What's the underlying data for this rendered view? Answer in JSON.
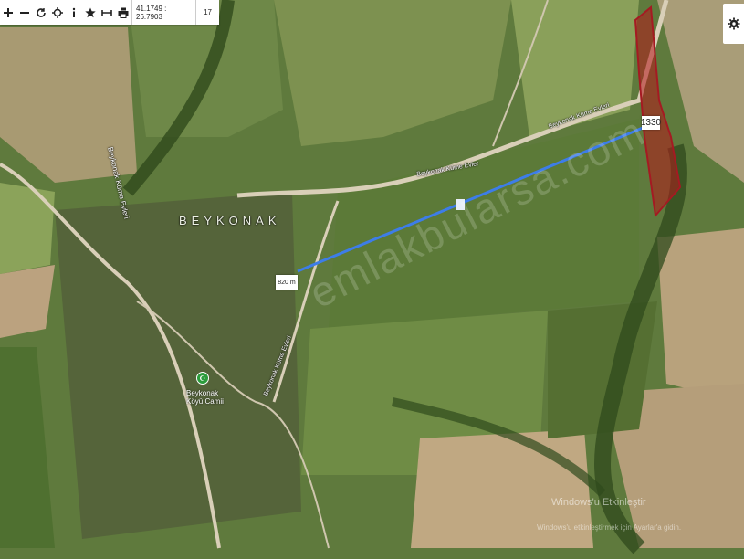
{
  "toolbar": {
    "icons": [
      "plus-icon",
      "minus-icon",
      "refresh-icon",
      "locate-icon",
      "info-icon",
      "star-icon",
      "measure-icon",
      "print-icon"
    ],
    "coordinates": "41.1749 : 26.7903",
    "zoom_level": "17"
  },
  "map_labels": {
    "village": "BEYKONAK",
    "road_west": "Beykonak Küme Evleri",
    "road_center": "Beykonak Küme Evler",
    "road_northeast": "Beykonak Küme Evleri",
    "road_south": "Beykonak Küme Evleri",
    "poi": "Beykonak Köyü Camii"
  },
  "measurement": {
    "start_label": "820 m",
    "end_label": "1330"
  },
  "watermark": "emlakbularsa.com",
  "os_overlay": {
    "title": "Windows'u Etkinleştir",
    "subtitle": "Windows'u etkinleştirmek için Ayarlar'a gidin."
  },
  "colors": {
    "parcel_fill": "#b3181a",
    "parcel_stroke": "#a51a22",
    "measure_line": "#3d7de8",
    "toolbar_bg": "#ffffff"
  }
}
